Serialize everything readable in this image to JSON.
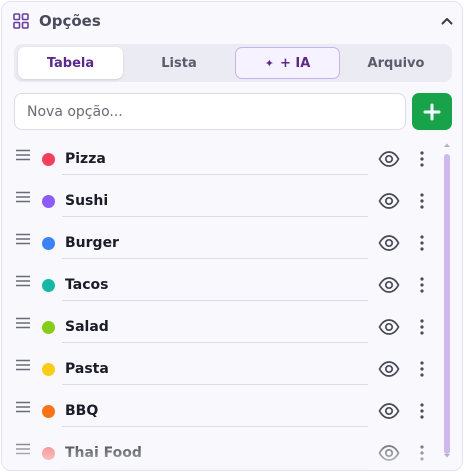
{
  "panel": {
    "title": "Opções",
    "icons": {
      "title": "grid-icon",
      "collapse": "chevron-up-icon"
    }
  },
  "tabs": [
    {
      "label": "Tabela",
      "active": true
    },
    {
      "label": "Lista",
      "active": false
    },
    {
      "label": "+ IA",
      "active": false,
      "icon": "sparkles-icon"
    },
    {
      "label": "Arquivo",
      "active": false
    }
  ],
  "new_option": {
    "placeholder": "Nova opção...",
    "value": "",
    "add_icon": "plus-icon"
  },
  "options": [
    {
      "label": "Pizza",
      "color": "#f43f5e"
    },
    {
      "label": "Sushi",
      "color": "#8b5cf6"
    },
    {
      "label": "Burger",
      "color": "#3b82f6"
    },
    {
      "label": "Tacos",
      "color": "#14b8a6"
    },
    {
      "label": "Salad",
      "color": "#84cc16"
    },
    {
      "label": "Pasta",
      "color": "#facc15"
    },
    {
      "label": "BBQ",
      "color": "#f97316"
    },
    {
      "label": "Thai Food",
      "color": "#f87171"
    }
  ],
  "colors": {
    "accent": "#5b2a8c",
    "add_button": "#16a34a",
    "scrollbar": "#cdb8ef"
  }
}
